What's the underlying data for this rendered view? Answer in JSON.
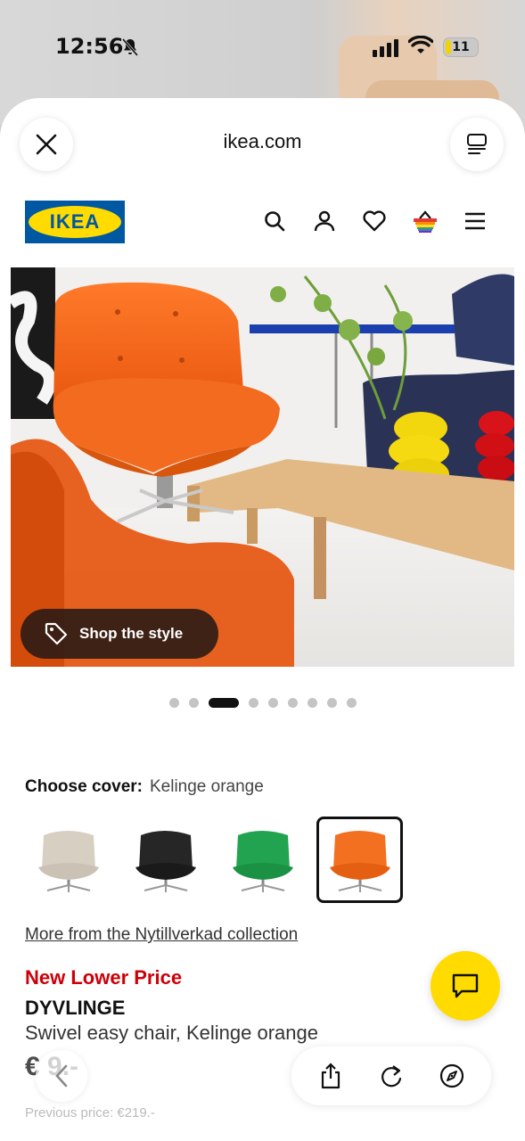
{
  "status_bar": {
    "time": "12:56",
    "battery": "11"
  },
  "browser": {
    "url": "ikea.com"
  },
  "ikea": {
    "logo_text": "IKEA",
    "brand_blue": "#0058a3",
    "brand_yellow": "#ffdb00"
  },
  "hero": {
    "shop_label": "Shop the style"
  },
  "carousel": {
    "total": 10,
    "active_index": 2
  },
  "cover": {
    "label": "Choose cover:",
    "value": "Kelinge orange",
    "options": [
      {
        "color": "#d8cfc3",
        "selected": false
      },
      {
        "color": "#1f1f1f",
        "selected": false
      },
      {
        "color": "#1e9e4a",
        "selected": false
      },
      {
        "color": "#f06a1c",
        "selected": true
      }
    ]
  },
  "product": {
    "collection_link": "More from the Nytillverkad collection",
    "badge": "New Lower Price",
    "name": "DYVLINGE",
    "description": "Swivel easy chair, Kelinge orange",
    "price": "€ 9.-",
    "previous_price": "Previous price: €219.-",
    "price_color": "#cc0008"
  },
  "icons": [
    "close-icon",
    "tabs-icon",
    "search-icon",
    "user-icon",
    "heart-icon",
    "basket-icon",
    "menu-icon",
    "tag-icon",
    "chat-icon",
    "back-icon",
    "share-icon",
    "reload-icon",
    "compass-icon"
  ]
}
